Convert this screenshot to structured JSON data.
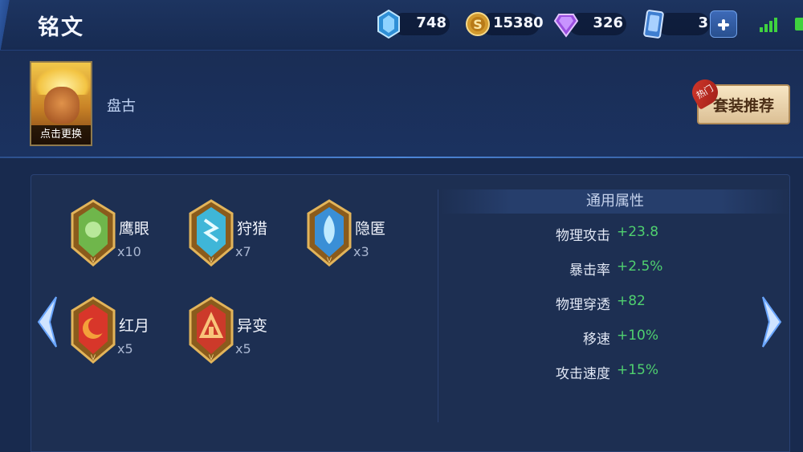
{
  "page_title": "铭文",
  "resources": [
    {
      "name": "diamond",
      "icon": "diamond-icon",
      "value": "748"
    },
    {
      "name": "gold",
      "icon": "gold-coin-icon",
      "value": "15380"
    },
    {
      "name": "gem",
      "icon": "purple-gem-icon",
      "value": "326"
    },
    {
      "name": "card",
      "icon": "card-icon",
      "value": "3"
    }
  ],
  "hero": {
    "name": "盘古",
    "change_label": "点击更换"
  },
  "set_button": {
    "label": "套装推荐",
    "badge": "热门"
  },
  "runes": [
    {
      "name": "鹰眼",
      "count": "x10",
      "color": "#6fb64b"
    },
    {
      "name": "狩猎",
      "count": "x7",
      "color": "#3fb6d8"
    },
    {
      "name": "隐匿",
      "count": "x3",
      "color": "#3a8fd6"
    },
    {
      "name": "红月",
      "count": "x5",
      "color": "#d8362a"
    },
    {
      "name": "异变",
      "count": "x5",
      "color": "#cc3a2a"
    }
  ],
  "attributes": {
    "title": "通用属性",
    "rows": [
      {
        "name": "物理攻击",
        "value": "+23.8"
      },
      {
        "name": "暴击率",
        "value": "+2.5%"
      },
      {
        "name": "物理穿透",
        "value": "+82"
      },
      {
        "name": "移速",
        "value": "+10%"
      },
      {
        "name": "攻击速度",
        "value": "+15%"
      }
    ]
  },
  "colors": {
    "accent_green": "#4fd06f",
    "background": "#182a4e",
    "rune_frame_gold": "#b88a3c"
  }
}
